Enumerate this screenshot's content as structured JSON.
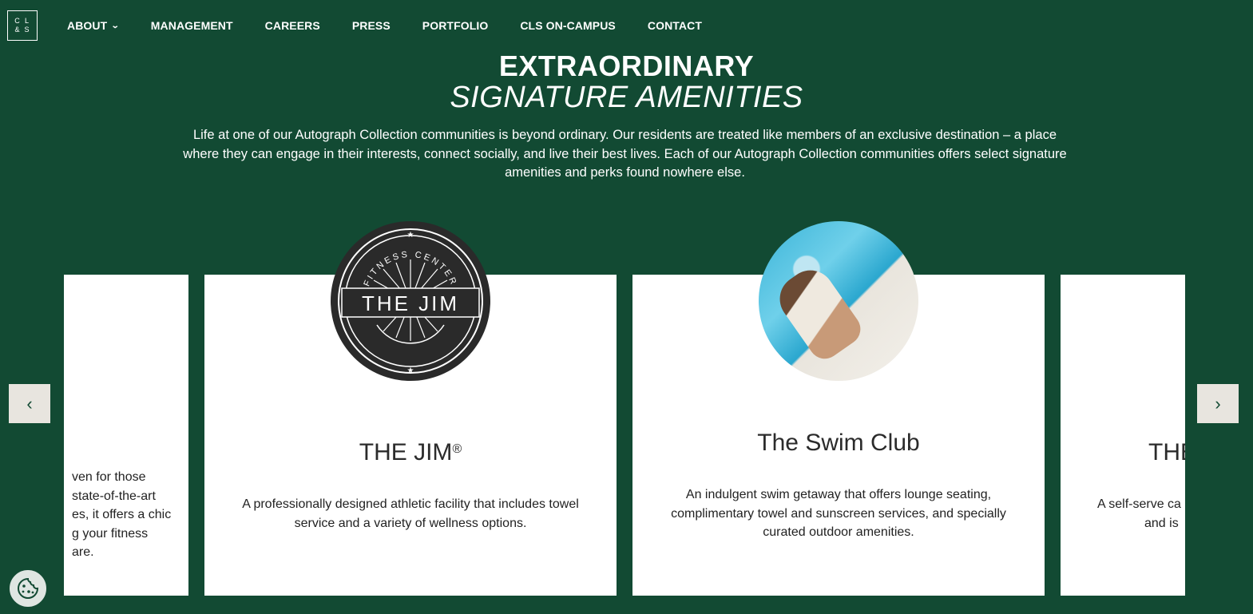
{
  "logo": {
    "letters": [
      "C",
      "L",
      "&",
      "S"
    ]
  },
  "nav": {
    "items": [
      {
        "label": "ABOUT",
        "has_dropdown": true
      },
      {
        "label": "MANAGEMENT"
      },
      {
        "label": "CAREERS"
      },
      {
        "label": "PRESS"
      },
      {
        "label": "PORTFOLIO"
      },
      {
        "label": "CLS ON-CAMPUS"
      },
      {
        "label": "CONTACT"
      }
    ]
  },
  "hero": {
    "title": "EXTRAORDINARY",
    "subtitle": "SIGNATURE AMENITIES",
    "intro": "Life at one of our Autograph Collection communities is beyond ordinary. Our residents are treated like members of an exclusive destination – a place where they can engage in their interests, connect socially, and live their best lives. Each of our Autograph Collection communities offers select signature amenities and perks found nowhere else."
  },
  "cards": [
    {
      "title": "",
      "desc_lines": [
        "ven for those",
        "state-of-the-art",
        "es, it offers a chic",
        "g your fitness",
        "are."
      ]
    },
    {
      "title": "THE JIM",
      "title_mark": "®",
      "badge": {
        "ring_text": "FITNESS CENTER",
        "center_text": "THE JIM"
      },
      "desc": "A professionally designed athletic facility that includes towel service and a variety of wellness options."
    },
    {
      "title": "The Swim Club",
      "desc": "An indulgent swim getaway that offers lounge seating, complimentary towel and sunscreen services, and specially curated outdoor amenities."
    },
    {
      "title": "THE",
      "desc_lines": [
        "A self-serve ca",
        "and is"
      ]
    }
  ],
  "arrows": {
    "prev": "‹",
    "next": "›"
  },
  "colors": {
    "background": "#124a33",
    "card": "#ffffff",
    "arrow_bg": "#e8e5df",
    "badge": "#2a2a2a"
  }
}
